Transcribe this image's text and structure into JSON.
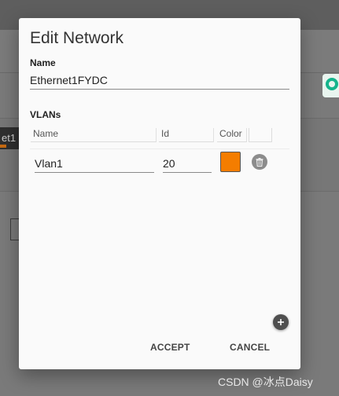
{
  "background": {
    "chip_text": "et1"
  },
  "dialog": {
    "title": "Edit Network",
    "name_label": "Name",
    "name_value": "Ethernet1FYDC",
    "vlans_label": "VLANs",
    "columns": [
      "Name",
      "Id",
      "Color"
    ],
    "rows": [
      {
        "name": "Vlan1",
        "id": "20",
        "color": "#f47d00"
      }
    ],
    "accept_label": "ACCEPT",
    "cancel_label": "CANCEL"
  },
  "watermark": "CSDN @冰点Daisy",
  "colors": {
    "vlan_swatch": "#f47d00",
    "grammarly_badge": "#15b48c"
  },
  "icons": {
    "delete": "trash-icon",
    "add": "plus-icon",
    "extension": "grammarly-icon"
  }
}
